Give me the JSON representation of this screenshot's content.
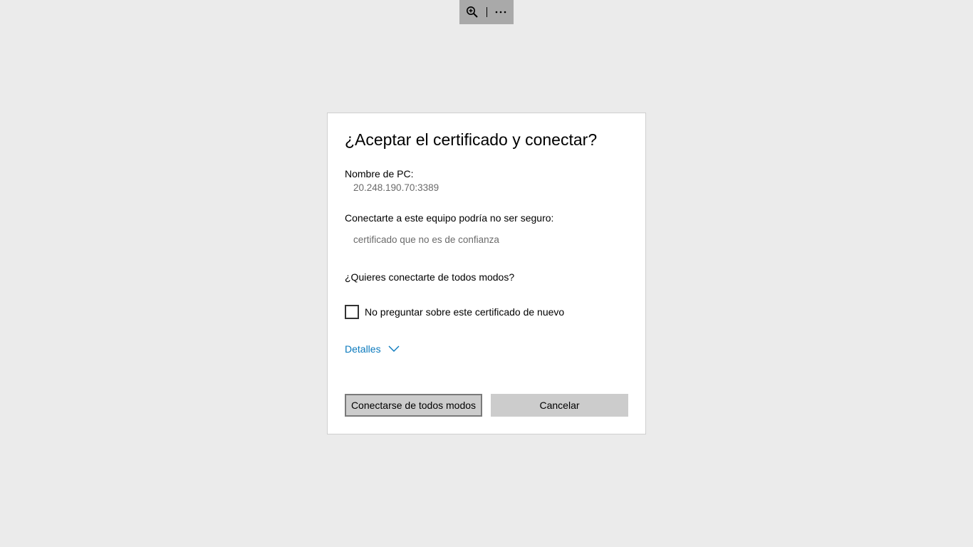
{
  "toolbar": {
    "zoom_icon": "zoom-in-icon",
    "more_icon": "more-options-icon",
    "more_label": "⋯"
  },
  "dialog": {
    "title": "¿Aceptar el certificado y conectar?",
    "pc_name_label": "Nombre de PC:",
    "pc_name_value": "20.248.190.70:3389",
    "warning_label": "Conectarte a este equipo podría no ser seguro:",
    "warning_value": "certificado que no es de confianza",
    "question": "¿Quieres conectarte de todos modos?",
    "dont_ask_label": "No preguntar sobre este certificado de nuevo",
    "dont_ask_checked": false,
    "details_label": "Detalles",
    "connect_button": "Conectarse de todos modos",
    "cancel_button": "Cancelar"
  },
  "colors": {
    "background": "#ebebeb",
    "link": "#0a79bd",
    "button": "#cccccc"
  }
}
